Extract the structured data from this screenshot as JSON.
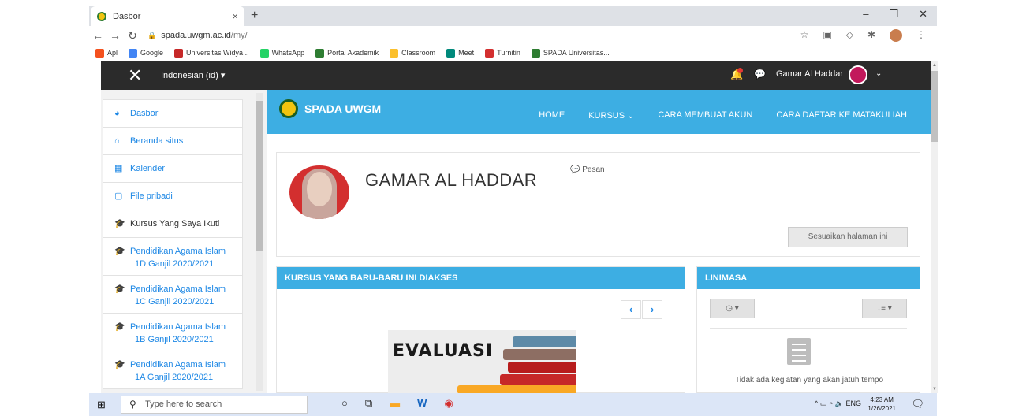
{
  "browser": {
    "tab_title": "Dasbor",
    "tab_close": "×",
    "new_tab": "+",
    "window_controls": [
      "–",
      "❐",
      "✕"
    ],
    "url_host": "spada.uwgm.ac.id",
    "url_path": "/my/",
    "bookmarks": [
      {
        "label": "Apl",
        "color": "#f4511e"
      },
      {
        "label": "Google",
        "color": "#4285f4"
      },
      {
        "label": "Universitas Widya...",
        "color": "#c62828"
      },
      {
        "label": "WhatsApp",
        "color": "#25d366"
      },
      {
        "label": "Portal Akademik",
        "color": "#2e7d32"
      },
      {
        "label": "Classroom",
        "color": "#fbc02d"
      },
      {
        "label": "Meet",
        "color": "#00897b"
      },
      {
        "label": "Turnitin",
        "color": "#d32f2f"
      },
      {
        "label": "SPADA Universitas...",
        "color": "#2e7d32"
      }
    ]
  },
  "topnav": {
    "close": "✕",
    "language": "Indonesian (id) ▾",
    "user_name": "Gamar Al Haddar",
    "chevron": "⌄"
  },
  "sidebar": {
    "items": [
      {
        "icon": "dashboard-icon",
        "label": "Dasbor"
      },
      {
        "icon": "home-icon",
        "label": "Beranda situs"
      },
      {
        "icon": "calendar-icon",
        "label": "Kalender"
      },
      {
        "icon": "file-icon",
        "label": "File pribadi"
      },
      {
        "icon": "graduation-cap-icon",
        "label": "Kursus Yang Saya Ikuti"
      },
      {
        "icon": "graduation-cap-icon",
        "label": "Pendidikan Agama Islam",
        "sub": "1D Ganjil 2020/2021"
      },
      {
        "icon": "graduation-cap-icon",
        "label": "Pendidikan Agama Islam",
        "sub": "1C Ganjil 2020/2021"
      },
      {
        "icon": "graduation-cap-icon",
        "label": "Pendidikan Agama Islam",
        "sub": "1B Ganjil 2020/2021"
      },
      {
        "icon": "graduation-cap-icon",
        "label": "Pendidikan Agama Islam",
        "sub": "1A Ganjil 2020/2021"
      }
    ]
  },
  "header": {
    "site_name": "SPADA UWGM",
    "nav": [
      "HOME",
      "KURSUS ⌄",
      "CARA MEMBUAT AKUN",
      "CARA DAFTAR KE MATAKULIAH"
    ]
  },
  "profile": {
    "name": "GAMAR AL HADDAR",
    "message_label": "Pesan",
    "customize_button": "Sesuaikan halaman ini"
  },
  "recent_courses": {
    "title": "KURSUS YANG BARU-BARU INI DIAKSES",
    "prev": "‹",
    "next": "›",
    "course_image_text": "EVALUASI"
  },
  "timeline": {
    "title": "LINIMASA",
    "filter_button": "◷ ▾",
    "sort_button": "↓≡ ▾",
    "empty_text": "Tidak ada kegiatan yang akan jatuh tempo"
  },
  "taskbar": {
    "search_placeholder": "Type here to search",
    "tray": "^ ▭ ◔ 🔈 ENG",
    "time": "4:23 AM",
    "date": "1/26/2021"
  },
  "colors": {
    "accent_blue": "#3daee3",
    "link_blue": "#1e88e5",
    "navbar_dark": "#2b2b2b"
  }
}
